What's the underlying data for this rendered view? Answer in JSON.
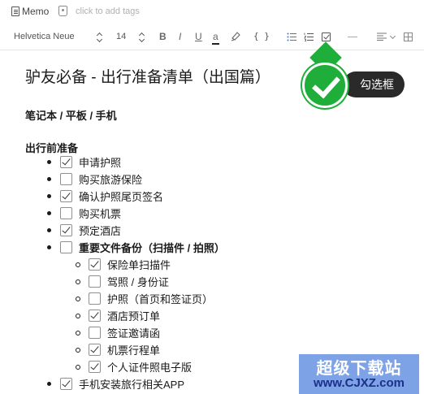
{
  "meta": {
    "memo_label": "Memo",
    "tag_placeholder": "click to add tags"
  },
  "toolbar": {
    "font_family": "Helvetica Neue",
    "font_size": "14",
    "bold": "B",
    "italic": "I",
    "underline": "U",
    "text_color": "a",
    "code": "{ }"
  },
  "callout": {
    "label": "勾选框",
    "color": "#1fae3a"
  },
  "note": {
    "title": "驴友必备 - 出行准备清单（出国篇）",
    "section_devices": "笔记本 / 平板 / 手机",
    "section_prep": "出行前准备",
    "items": [
      {
        "text": "申请护照",
        "checked": true
      },
      {
        "text": "购买旅游保险",
        "checked": false
      },
      {
        "text": "确认护照尾页签名",
        "checked": true
      },
      {
        "text": "购买机票",
        "checked": false
      },
      {
        "text": "预定酒店",
        "checked": true
      },
      {
        "text": "重要文件备份（扫描件 / 拍照）",
        "checked": false,
        "bold": true
      }
    ],
    "subitems": [
      {
        "text": "保险单扫描件",
        "checked": true
      },
      {
        "text": "驾照 / 身份证",
        "checked": false
      },
      {
        "text": "护照（首页和签证页）",
        "checked": false
      },
      {
        "text": "酒店预订单",
        "checked": true
      },
      {
        "text": "签证邀请函",
        "checked": false
      },
      {
        "text": "机票行程单",
        "checked": true
      },
      {
        "text": "个人证件照电子版",
        "checked": true
      }
    ],
    "last_item": {
      "text": "手机安装旅行相关APP",
      "checked": true
    }
  },
  "watermark": {
    "line1": "超级下载站",
    "line2": "www.CJXZ.com"
  }
}
